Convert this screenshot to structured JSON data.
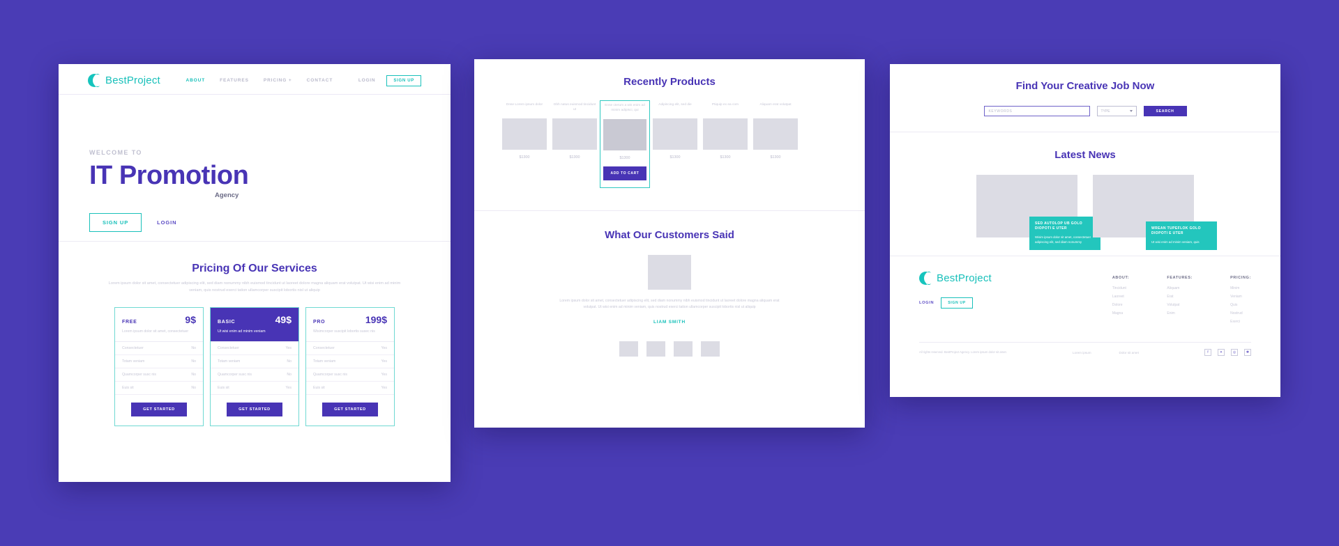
{
  "brand": {
    "name": "BestProject"
  },
  "landing": {
    "nav": [
      {
        "label": "ABOUT",
        "active": true
      },
      {
        "label": "FEATURES",
        "active": false
      },
      {
        "label": "PRICING +",
        "active": false
      },
      {
        "label": "CONTACT",
        "active": false
      }
    ],
    "login_label": "LOGIN",
    "signup_label": "SIGN UP",
    "hero": {
      "kicker": "WELCOME TO",
      "title": "IT Promotion",
      "subtitle": "Agency",
      "signup_label": "SIGN UP",
      "login_label": "LOGIN"
    },
    "pricing": {
      "title": "Pricing Of Our Services",
      "subtitle": "Lorem ipsum dolor sit amet, consectetuer adipiscing elit, sed diam nonummy nibh euismod tincidunt ut laoreet dolore magna aliquam erat volutpat. Ut wisi enim ad minim veniam, quis nostrud exerci tation ullamcorper suscipit lobortis nisl ut aliquip",
      "cta_label": "GET STARTED",
      "plans": [
        {
          "name": "FREE",
          "price": "9$",
          "desc": "Lorem ipsum dolor sit amet, consectetuer",
          "featured": false,
          "features": [
            {
              "label": "Consectetuer",
              "value": "No"
            },
            {
              "label": "Totam veniam",
              "value": "No"
            },
            {
              "label": "Quamcorper susc nis",
              "value": "No"
            },
            {
              "label": "Euis sit",
              "value": "No"
            }
          ]
        },
        {
          "name": "BASIC",
          "price": "49$",
          "desc": "Ut wisi enim ad minim veniam",
          "featured": true,
          "features": [
            {
              "label": "Consectetuer",
              "value": "Yes"
            },
            {
              "label": "Totam veniam",
              "value": "No"
            },
            {
              "label": "Quamcorper susc nis",
              "value": "No"
            },
            {
              "label": "Euis sit",
              "value": "Yes"
            }
          ]
        },
        {
          "name": "PRO",
          "price": "199$",
          "desc": "Wisimcorper suscipit lobortis susec nis",
          "featured": false,
          "features": [
            {
              "label": "Consectetuer",
              "value": "Yes"
            },
            {
              "label": "Totam veniam",
              "value": "Yes"
            },
            {
              "label": "Quamcorper susc nis",
              "value": "Yes"
            },
            {
              "label": "Euis sit",
              "value": "Yes"
            }
          ]
        }
      ]
    }
  },
  "products": {
    "title": "Recently Products",
    "add_to_cart_label": "ADD TO CART",
    "items": [
      {
        "name": "Dnse Lorem ipsum dolor",
        "price": "$1300",
        "selected": false
      },
      {
        "name": "Gbh natus euismod tincidunt ut",
        "price": "$1300",
        "selected": false
      },
      {
        "name": "Ense cterum a wis enim ad minim adipisci, qui",
        "price": "$1300",
        "selected": true
      },
      {
        "name": "Adipiscing elit, sed die",
        "price": "$1300",
        "selected": false
      },
      {
        "name": "Ptiquip ex ea com",
        "price": "$1300",
        "selected": false
      },
      {
        "name": "Aliquam erat volutpat",
        "price": "$1300",
        "selected": false
      }
    ],
    "testimonial": {
      "title": "What Our Customers Said",
      "text": "Lorem ipsum dolor sit amet, consectetuer adipiscing elit, sed diam nonummy nibh euismod tincidunt ut laoreet dolore magna aliquam erat volutpat. Ut wisi enim ad minim veniam, quis nostrud exerci tation ullamcorper suscipit lobortis nisl ut aliquip",
      "author": "LIAM SMITH"
    }
  },
  "jobs": {
    "title": "Find Your Creative Job Now",
    "search": {
      "placeholder": "KEYWORDS",
      "value": "",
      "select_value": "TYPE",
      "button_label": "SEARCH"
    },
    "news": {
      "title": "Latest News",
      "cards": [
        {
          "headline": "SED AUTOLOP UB GOLO DIOPOTI E UTER",
          "body": "Wisim ipsum dolor sit amet, consectetuer adipiscing elit, sed diam nonummy"
        },
        {
          "headline": "WREAN TUPEFLOK GOLO DIOPOTI E UTER",
          "body": "Ut wisi enim ad minim veniam, quis"
        }
      ]
    },
    "footer": {
      "login_label": "LOGIN",
      "signup_label": "SIGN UP",
      "columns": [
        {
          "heading": "ABOUT:",
          "links": [
            "Tincidunt",
            "Laoreet",
            "Dolore",
            "Magna"
          ]
        },
        {
          "heading": "FEATURES:",
          "links": [
            "Aliquam",
            "Erat",
            "Volutpat",
            "Enim"
          ]
        },
        {
          "heading": "PRICING:",
          "links": [
            "Minim",
            "Veniam",
            "Quis",
            "Nostrud",
            "Exerci"
          ]
        }
      ],
      "copyright": "All rights reserved. BestProject Agency. Lorem ipsum dolor sit amet.",
      "links": [
        "Lorem ipsum",
        "Dolor sit amet"
      ],
      "socials": [
        "facebook-icon",
        "twitter-icon",
        "instagram-icon",
        "pinterest-icon"
      ]
    }
  }
}
